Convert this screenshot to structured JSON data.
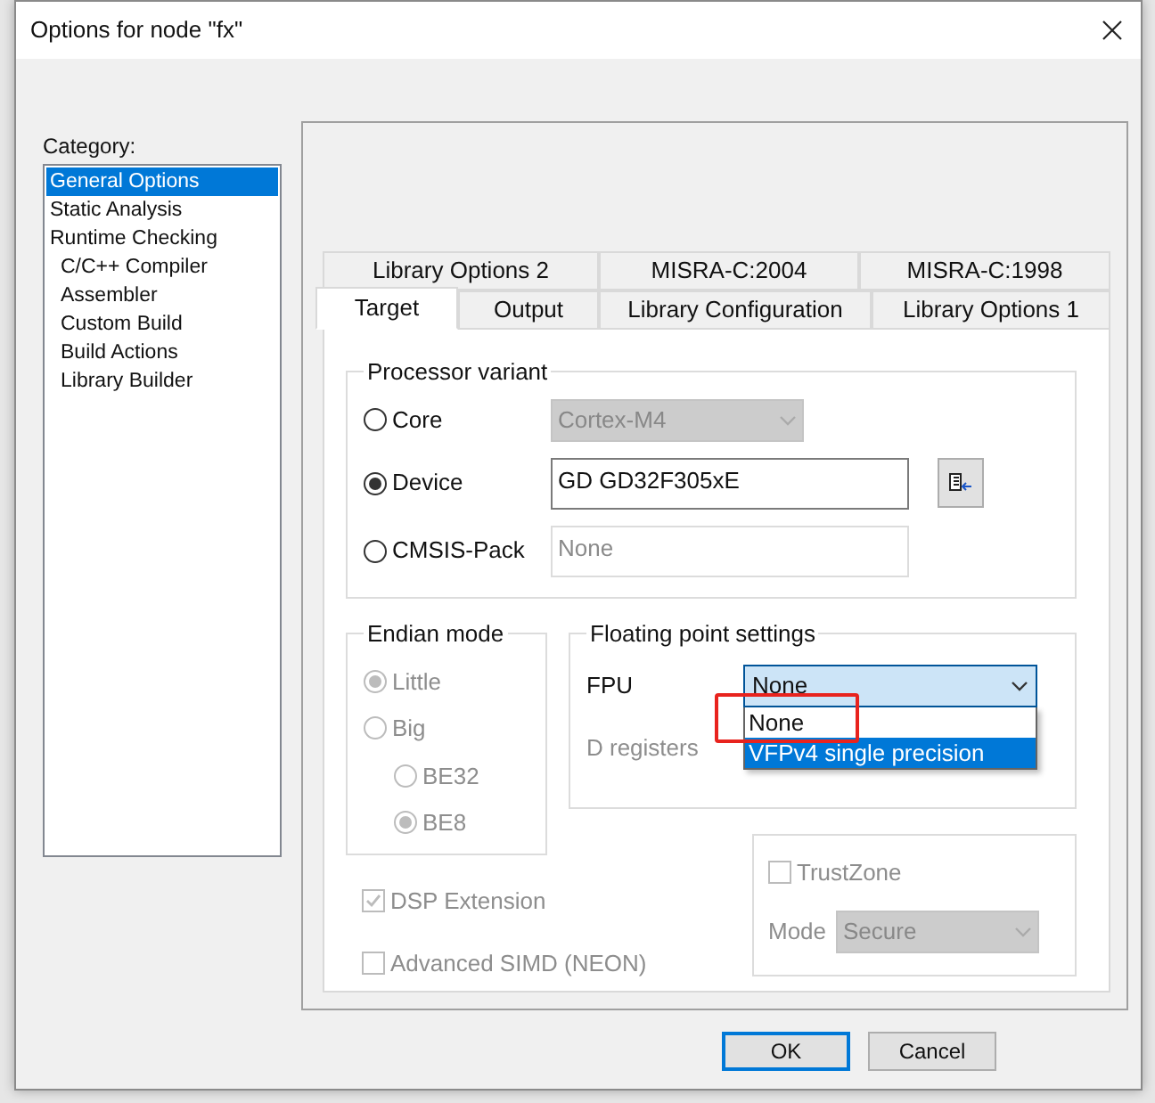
{
  "window": {
    "title": "Options for node \"fx\""
  },
  "category": {
    "label": "Category:",
    "items": [
      {
        "label": "General Options",
        "kind": "top",
        "selected": true
      },
      {
        "label": "Static Analysis",
        "kind": "top",
        "selected": false
      },
      {
        "label": "Runtime Checking",
        "kind": "top",
        "selected": false
      },
      {
        "label": "C/C++ Compiler",
        "kind": "sub",
        "selected": false
      },
      {
        "label": "Assembler",
        "kind": "sub",
        "selected": false
      },
      {
        "label": "Custom Build",
        "kind": "sub",
        "selected": false
      },
      {
        "label": "Build Actions",
        "kind": "sub",
        "selected": false
      },
      {
        "label": "Library Builder",
        "kind": "sub",
        "selected": false
      }
    ]
  },
  "tabs": {
    "back_row": [
      {
        "label": "Library Options 2",
        "selected": false
      },
      {
        "label": "MISRA-C:2004",
        "selected": false
      },
      {
        "label": "MISRA-C:1998",
        "selected": false
      }
    ],
    "front_row": [
      {
        "label": "Target",
        "selected": true
      },
      {
        "label": "Output",
        "selected": false
      },
      {
        "label": "Library Configuration",
        "selected": false
      },
      {
        "label": "Library Options 1",
        "selected": false
      }
    ]
  },
  "processor_variant": {
    "title": "Processor variant",
    "options": [
      {
        "label": "Core",
        "selected": false,
        "kind": "select",
        "value": "Cortex-M4",
        "disabled": true
      },
      {
        "label": "Device",
        "selected": true,
        "kind": "device",
        "value": "GD GD32F305xE",
        "disabled": false
      },
      {
        "label": "CMSIS-Pack",
        "selected": false,
        "kind": "text",
        "value": "None",
        "disabled": true
      }
    ]
  },
  "endian_mode": {
    "title": "Endian mode",
    "disabled": true,
    "options": [
      {
        "label": "Little",
        "selected": true
      },
      {
        "label": "Big",
        "selected": false,
        "children": [
          {
            "label": "BE32",
            "selected": false
          },
          {
            "label": "BE8",
            "selected": true
          }
        ]
      }
    ]
  },
  "floating_point": {
    "title": "Floating point settings",
    "fpu_label": "FPU",
    "value": "None",
    "expanded": true,
    "options": [
      {
        "label": "None",
        "highlighted": false
      },
      {
        "label": "VFPv4 single precision",
        "highlighted": true
      }
    ],
    "d_registers_label": "D registers",
    "d_registers_disabled": true
  },
  "checkboxes": [
    {
      "label": "DSP Extension",
      "checked": true,
      "disabled": true
    },
    {
      "label": "Advanced SIMD (NEON)",
      "checked": false,
      "disabled": true
    }
  ],
  "trustzone": {
    "label": "TrustZone",
    "checked": false,
    "disabled": true,
    "mode_label": "Mode",
    "mode_value": "Secure"
  },
  "buttons": [
    {
      "label": "OK",
      "default": true
    },
    {
      "label": "Cancel",
      "default": false
    }
  ],
  "annotation": {
    "kind": "box",
    "color": "#e8231e"
  }
}
